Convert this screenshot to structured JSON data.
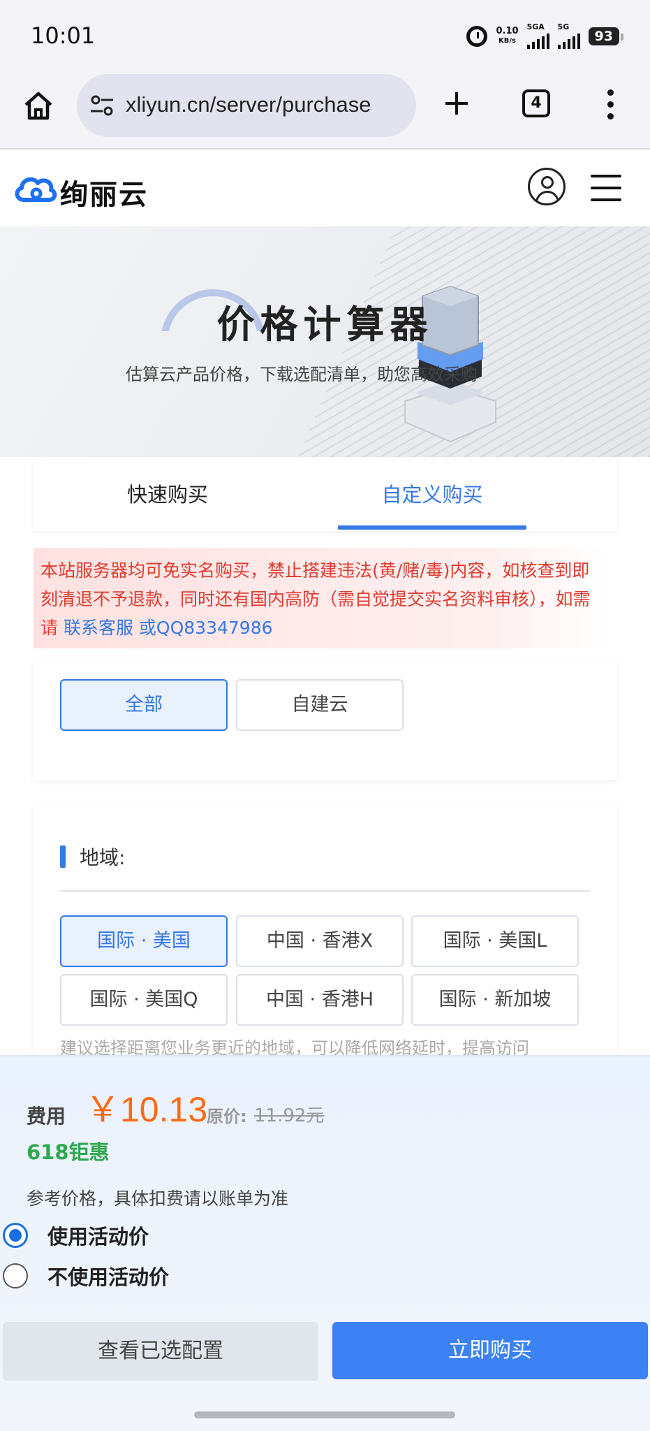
{
  "status_bar": {
    "time": "10:01",
    "net_speed_value": "0.10",
    "net_speed_unit": "KB/s",
    "signal1_label": "5GA",
    "signal2_label": "5G",
    "battery": "93"
  },
  "browser": {
    "url": "xliyun.cn/server/purchase",
    "tab_count": "4"
  },
  "site": {
    "logo_text": "绚丽云"
  },
  "hero": {
    "title": "价格计算器",
    "subtitle": "估算云产品价格，下载选配清单，助您高效采购"
  },
  "tabs": [
    {
      "label": "快速购买",
      "active": false
    },
    {
      "label": "自定义购买",
      "active": true
    }
  ],
  "notice": {
    "text": "本站服务器均可免实名购买，禁止搭建违法(黄/赌/毒)内容，如核查到即刻清退不予退款，同时还有国内高防（需自觉提交实名资料审核），如需请 ",
    "link1": "联系客服",
    "link2": " 或QQ83347986"
  },
  "filter": {
    "options": [
      {
        "label": "全部",
        "active": true
      },
      {
        "label": "自建云",
        "active": false
      }
    ]
  },
  "region": {
    "label": "地域:",
    "options": [
      {
        "label": "国际 · 美国",
        "active": true
      },
      {
        "label": "中国 · 香港X",
        "active": false
      },
      {
        "label": "国际 · 美国L",
        "active": false
      },
      {
        "label": "国际 · 美国Q",
        "active": false
      },
      {
        "label": "中国 · 香港H",
        "active": false
      },
      {
        "label": "国际 · 新加坡",
        "active": false
      }
    ],
    "hint": "建议选择距离您业务更近的地域，可以降低网络延时，提高访问"
  },
  "pricing": {
    "fee_label": "费用",
    "price": "￥10.13",
    "original_label": "原价:",
    "original_value": "11.92元",
    "promo": "618钜惠",
    "reference": "参考价格，具体扣费请以账单为准",
    "radio_use": "使用活动价",
    "radio_no_use": "不使用活动价",
    "selected": "use"
  },
  "actions": {
    "view_config": "查看已选配置",
    "buy_now": "立即购买"
  },
  "colors": {
    "accent": "#3578e5",
    "price": "#ff6a13",
    "promo": "#2fa84f",
    "notice": "#e03b2f",
    "buy_button": "#3c82f4"
  }
}
